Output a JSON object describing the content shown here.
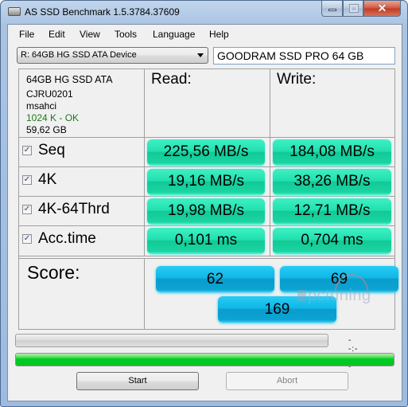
{
  "window": {
    "title": "AS SSD Benchmark 1.5.3784.37609",
    "controls": {
      "minimize": "minimize",
      "maximize": "maximize",
      "close": "✕"
    }
  },
  "menu": [
    "File",
    "Edit",
    "View",
    "Tools",
    "Language",
    "Help"
  ],
  "drive_select": {
    "value": "R: 64GB HG SSD ATA Device"
  },
  "name_input": {
    "value": "GOODRAM SSD PRO 64 GB"
  },
  "drive_info": {
    "model": "64GB HG SSD ATA",
    "firmware": "CJRU0201",
    "driver": "msahci",
    "alignment": "1024 K - OK",
    "size": "59,62 GB"
  },
  "headers": {
    "read": "Read:",
    "write": "Write:"
  },
  "tests": [
    {
      "label": "Seq",
      "checked": true,
      "read": "225,56 MB/s",
      "write": "184,08 MB/s"
    },
    {
      "label": "4K",
      "checked": true,
      "read": "19,16 MB/s",
      "write": "38,26 MB/s"
    },
    {
      "label": "4K-64Thrd",
      "checked": true,
      "read": "19,98 MB/s",
      "write": "12,71 MB/s"
    },
    {
      "label": "Acc.time",
      "checked": true,
      "read": "0,101 ms",
      "write": "0,704 ms"
    }
  ],
  "score": {
    "label": "Score:",
    "read": "62",
    "write": "69",
    "total": "169"
  },
  "watermark": "pctuning",
  "progress": {
    "elapsed": "--:--:--",
    "test_progress_percent": 0,
    "overall_progress_percent": 100
  },
  "buttons": {
    "start": "Start",
    "abort": "Abort"
  },
  "colors": {
    "result_green": "#22e0b0",
    "score_blue": "#10b6e6",
    "progress_green": "#00cc26",
    "ok_text": "#1a7a1a"
  }
}
